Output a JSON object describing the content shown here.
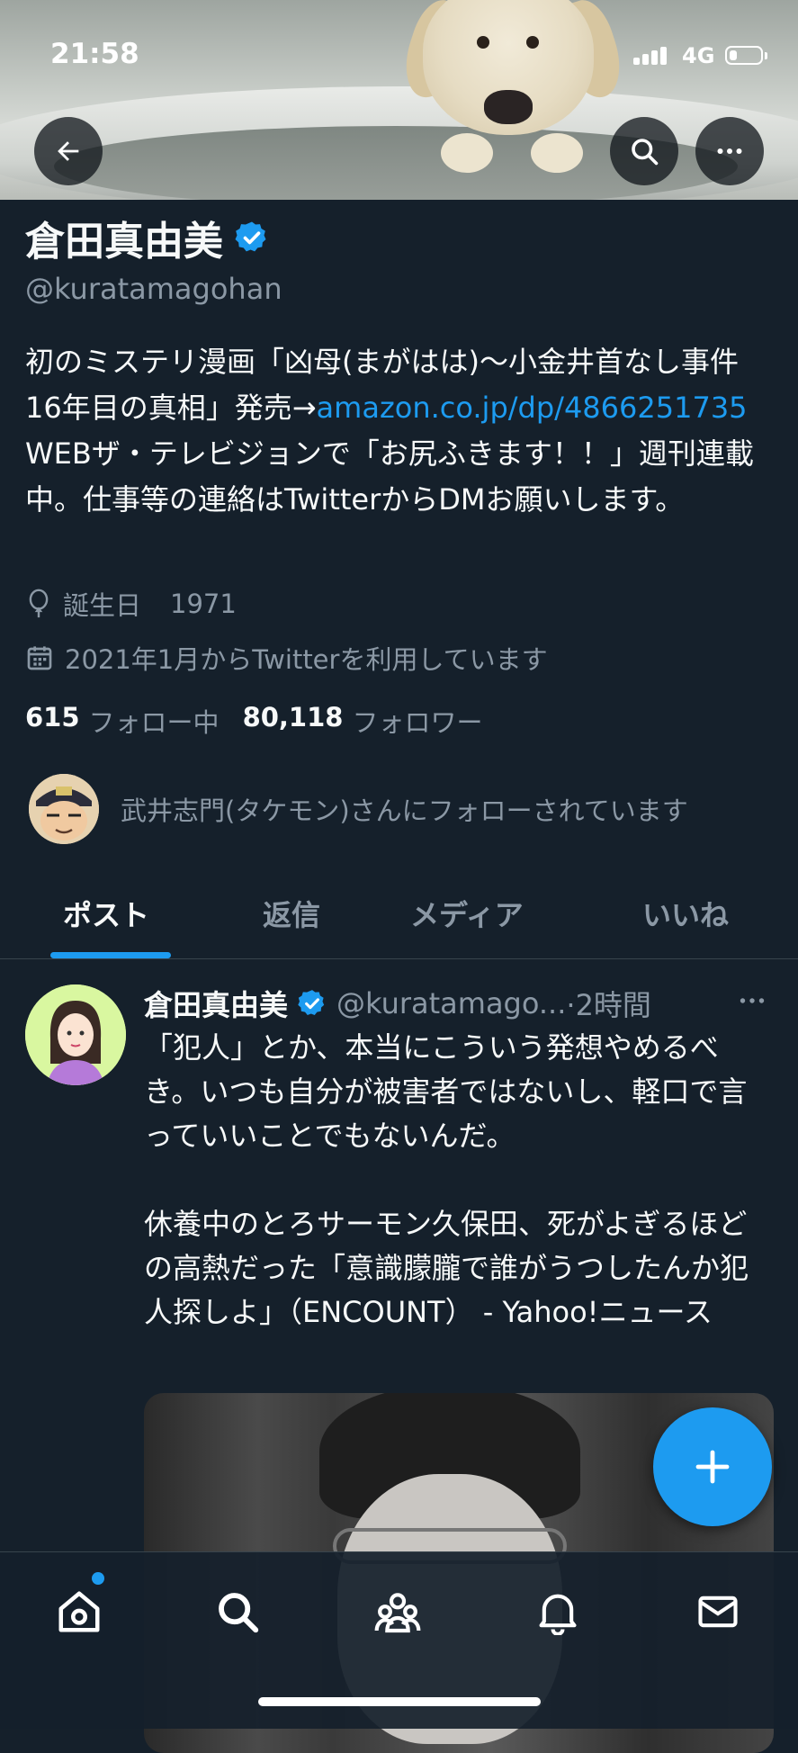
{
  "status_bar": {
    "time": "21:58",
    "network": "4G",
    "battery_fraction": 0.25
  },
  "colors": {
    "background": "#15202b",
    "accent": "#1d9bf0",
    "secondary_text": "#8b98a5"
  },
  "profile": {
    "display_name": "倉田真由美",
    "handle": "@kuratamagohan",
    "bio_text_1": "初のミステリ漫画「凶母(まがはは)〜小金井首なし事件16年目の真相」発売→",
    "bio_link": "amazon.co.jp/dp/4866251735",
    "bio_text_2": " WEBザ・テレビジョンで「お尻ふきます！！」週刊連載中。仕事等の連絡はTwitterからDMお願いします。",
    "birthday_label": "誕生日",
    "birthday_value": "1971",
    "joined": "2021年1月からTwitterを利用しています",
    "following_count": "615",
    "following_label": "フォロー中",
    "followers_count": "80,118",
    "followers_label": "フォロワー",
    "followed_by": "武井志門(タケモン)さんにフォローされています"
  },
  "tabs": [
    {
      "label": "ポスト",
      "active": true
    },
    {
      "label": "返信",
      "active": false
    },
    {
      "label": "メディア",
      "active": false
    },
    {
      "label": "いいね",
      "active": false
    }
  ],
  "tweet": {
    "author_name": "倉田真由美",
    "author_handle": "@kuratamago...",
    "time": "·2時間",
    "body": "「犯人」とか、本当にこういう発想やめるべき。いつも自分が被害者ではないし、軽口で言っていいことでもないんだ。\n\n休養中のとろサーモン久保田、死がよぎるほどの高熱だった「意識朦朧で誰がうつしたんか犯人探しよ」（ENCOUNT） - Yahoo!ニュース"
  },
  "icons": {
    "back": "arrow-left-icon",
    "search": "search-icon",
    "more": "more-horizontal-icon",
    "verified": "verified-badge-icon",
    "birthday": "balloon-icon",
    "joined": "calendar-icon",
    "compose": "plus-icon",
    "nav": [
      "home-icon",
      "search-icon",
      "communities-icon",
      "bell-icon",
      "mail-icon"
    ]
  }
}
